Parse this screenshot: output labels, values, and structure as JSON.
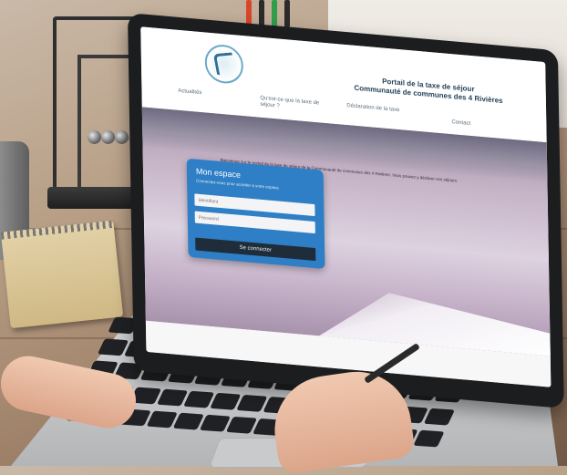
{
  "site": {
    "title_line1": "Portail de la taxe de séjour",
    "title_line2": "Communauté de communes des 4 Rivières",
    "nav": [
      "Actualités",
      "Qu'est-ce que la taxe de séjour ?",
      "Déclaration de la taxe",
      "Contact"
    ],
    "hero_tagline": "Bienvenue sur le portail de la taxe de séjour de la Communauté de communes des 4 Rivières. Vous pouvez y déclarer vos séjours.",
    "login": {
      "title": "Mon espace",
      "subtitle": "Connectez-vous pour accéder à votre espace",
      "identifier_placeholder": "Identifiant",
      "password_placeholder": "Password",
      "submit_label": "Se connecter"
    }
  },
  "colors": {
    "login_card": "#2f7fc6",
    "login_button": "#1f2c3a",
    "bezel": "#1c1d1f"
  },
  "icons": [
    "logo-emblem"
  ]
}
